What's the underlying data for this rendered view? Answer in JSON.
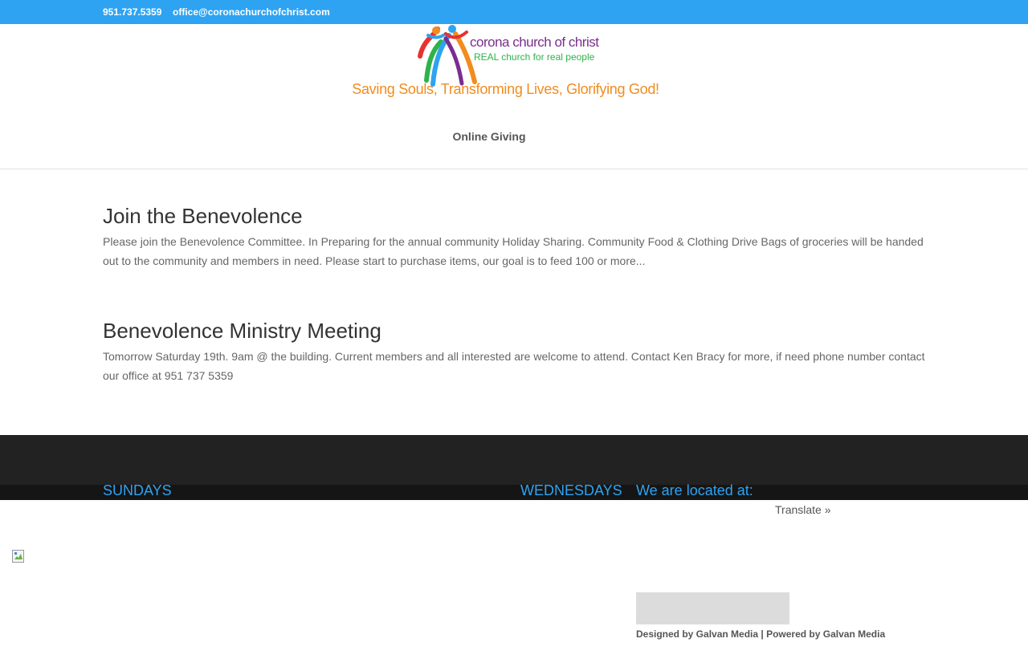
{
  "topbar": {
    "phone": "951.737.5359",
    "email": "office@coronachurchofchrist.com"
  },
  "logo": {
    "line1": "corona church of christ",
    "line2": "REAL church for real people"
  },
  "tagline": "Saving Souls, Transforming Lives, Glorifying God!",
  "nav": {
    "item": "Online Giving"
  },
  "posts": [
    {
      "title": "Join the Benevolence",
      "body": "Please join the Benevolence Committee. In Preparing for the annual community Holiday Sharing. Community Food & Clothing Drive Bags of groceries will be handed out to the community and members in need. Please start to purchase items, our goal is to feed 100 or more..."
    },
    {
      "title": "Benevolence Ministry Meeting",
      "body": "Tomorrow Saturday 19th. 9am @ the building. Current members and all interested are welcome to attend. Contact Ken Bracy for more, if need phone number contact our office at 951 737 5359"
    }
  ],
  "footer": {
    "col1": "SUNDAYS",
    "col2": "WEDNESDAYS",
    "col3": "We are located at:",
    "translate": "Translate »",
    "credit": "Designed by Galvan Media | Powered by Galvan Media"
  },
  "colors": {
    "accent": "#2ea3f2",
    "tagline": "#f28c1e",
    "footer_bg": "#222222"
  }
}
